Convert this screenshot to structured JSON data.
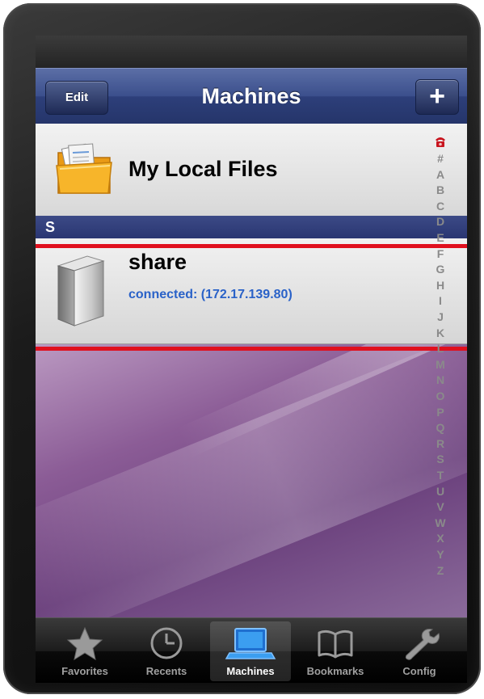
{
  "nav": {
    "title": "Machines",
    "edit_label": "Edit",
    "add_label": "+"
  },
  "rows": {
    "local_files": {
      "title": "My Local Files",
      "icon": "folder-icon"
    },
    "section_label": "S",
    "share": {
      "title": "share",
      "subtitle": "connected: (172.17.139.80)",
      "icon": "server-icon",
      "highlighted": true
    }
  },
  "index_bar": {
    "top_icon": "phone-icon",
    "letters": [
      "#",
      "A",
      "B",
      "C",
      "D",
      "E",
      "F",
      "G",
      "H",
      "I",
      "J",
      "K",
      "L",
      "M",
      "N",
      "O",
      "P",
      "Q",
      "R",
      "S",
      "T",
      "U",
      "V",
      "W",
      "X",
      "Y",
      "Z"
    ]
  },
  "tabs": [
    {
      "label": "Favorites",
      "icon": "star-icon",
      "active": false
    },
    {
      "label": "Recents",
      "icon": "clock-icon",
      "active": false
    },
    {
      "label": "Machines",
      "icon": "laptop-icon",
      "active": true
    },
    {
      "label": "Bookmarks",
      "icon": "book-icon",
      "active": false
    },
    {
      "label": "Config",
      "icon": "wrench-icon",
      "active": false
    }
  ],
  "colors": {
    "nav_blue": "#2d3f7a",
    "subtitle_blue": "#2a62c8",
    "highlight_red": "#e0101e",
    "active_tab_icon": "#3b9ef0"
  }
}
